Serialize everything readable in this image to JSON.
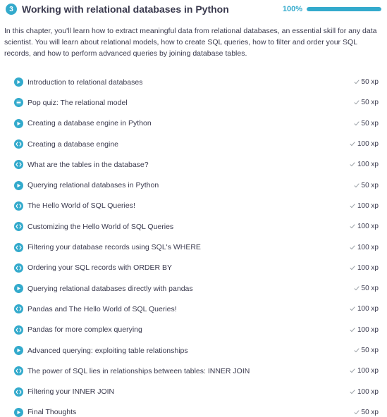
{
  "chapter": {
    "number": "3",
    "title": "Working with relational databases in Python",
    "progress_label": "100%",
    "progress_fraction": 1.0,
    "description": "In this chapter, you'll learn how to extract meaningful data from relational databases, an essential skill for any data scientist. You will learn about relational models, how to create SQL queries, how to filter and order your SQL records, and how to perform advanced queries by joining database tables."
  },
  "colors": {
    "accent": "#33aacc",
    "text": "#3a3a4e",
    "check": "#9aa0a6"
  },
  "exercises": [
    {
      "title": "Introduction to relational databases",
      "xp": "50 xp",
      "icon": "video-icon"
    },
    {
      "title": "Pop quiz: The relational model",
      "xp": "50 xp",
      "icon": "multiple-choice-icon"
    },
    {
      "title": "Creating a database engine in Python",
      "xp": "50 xp",
      "icon": "video-icon"
    },
    {
      "title": "Creating a database engine",
      "xp": "100 xp",
      "icon": "code-icon"
    },
    {
      "title": "What are the tables in the database?",
      "xp": "100 xp",
      "icon": "code-icon"
    },
    {
      "title": "Querying relational databases in Python",
      "xp": "50 xp",
      "icon": "video-icon"
    },
    {
      "title": "The Hello World of SQL Queries!",
      "xp": "100 xp",
      "icon": "code-icon"
    },
    {
      "title": "Customizing the Hello World of SQL Queries",
      "xp": "100 xp",
      "icon": "code-icon"
    },
    {
      "title": "Filtering your database records using SQL's WHERE",
      "xp": "100 xp",
      "icon": "code-icon"
    },
    {
      "title": "Ordering your SQL records with ORDER BY",
      "xp": "100 xp",
      "icon": "code-icon"
    },
    {
      "title": "Querying relational databases directly with pandas",
      "xp": "50 xp",
      "icon": "video-icon"
    },
    {
      "title": "Pandas and The Hello World of SQL Queries!",
      "xp": "100 xp",
      "icon": "code-icon"
    },
    {
      "title": "Pandas for more complex querying",
      "xp": "100 xp",
      "icon": "code-icon"
    },
    {
      "title": "Advanced querying: exploiting table relationships",
      "xp": "50 xp",
      "icon": "video-icon"
    },
    {
      "title": "The power of SQL lies in relationships between tables: INNER JOIN",
      "xp": "100 xp",
      "icon": "code-icon"
    },
    {
      "title": "Filtering your INNER JOIN",
      "xp": "100 xp",
      "icon": "code-icon"
    },
    {
      "title": "Final Thoughts",
      "xp": "50 xp",
      "icon": "video-icon"
    }
  ]
}
